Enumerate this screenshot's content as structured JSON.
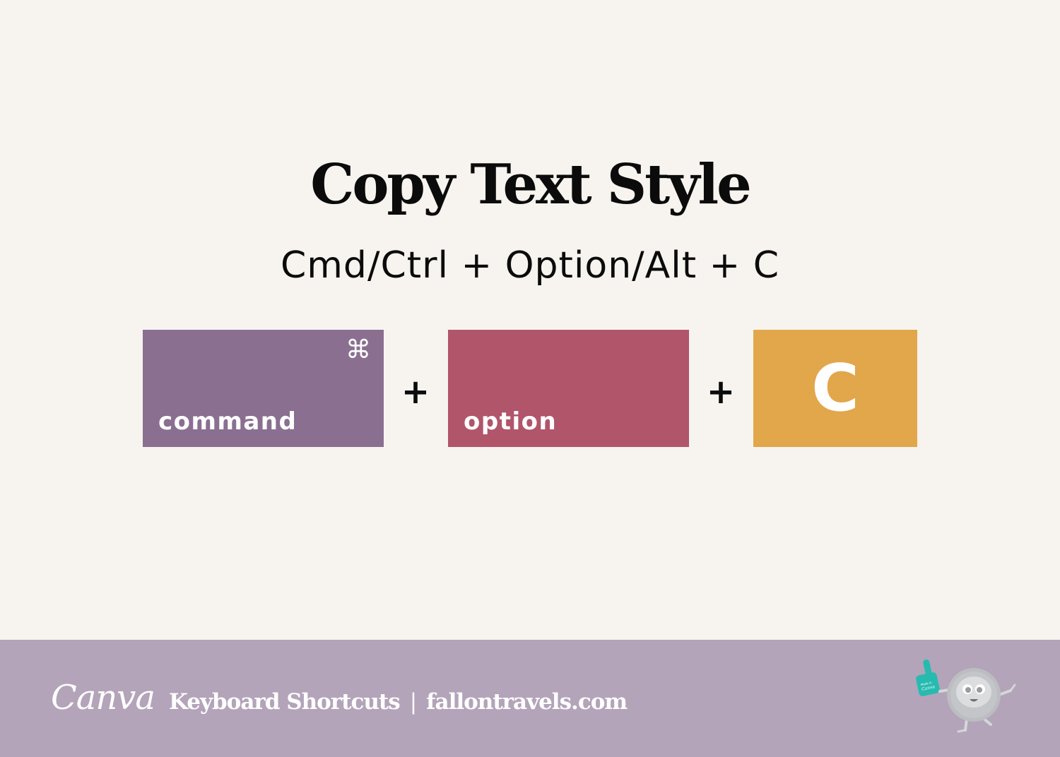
{
  "heading": {
    "title": "Copy Text Style",
    "shortcut": "Cmd/Ctrl + Option/Alt + C"
  },
  "keys": [
    {
      "label": "command",
      "glyph": "⌘",
      "icon": "command-icon",
      "color": "#8a6f91"
    },
    {
      "label": "option",
      "color": "#b1556b"
    },
    {
      "label": "C",
      "color": "#e2a64b"
    }
  ],
  "separators": [
    "+",
    "+"
  ],
  "footer": {
    "logo": "Canva",
    "title": "Keyboard Shortcuts",
    "separator": "|",
    "site": "fallontravels.com",
    "mascot_badge": "Made in Canva",
    "background": "#b3a4ba"
  },
  "colors": {
    "background": "#f7f4ef",
    "text": "#0b0b0b"
  }
}
